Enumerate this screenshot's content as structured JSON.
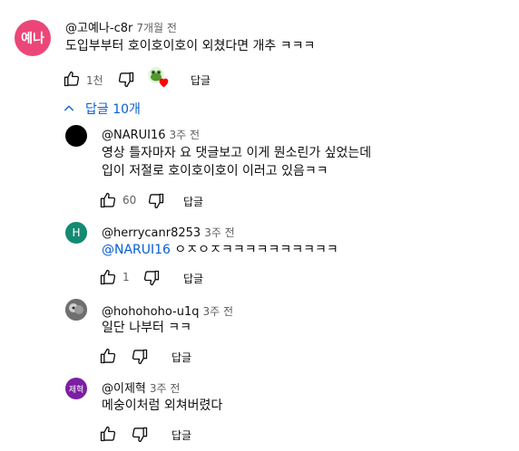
{
  "comment": {
    "avatar_text": "예나",
    "avatar_color": "#ec4679",
    "author": "@고예나-c8r",
    "time": "7개월 전",
    "text": "도입부부터 호이호이호이 외쳤다면 개추 ㅋㅋㅋ",
    "likes": "1천",
    "reply_label": "답글",
    "replies_toggle": "답글 10개"
  },
  "replies": [
    {
      "author": "@NARUI16",
      "time": "3주 전",
      "lines": [
        "영상 틀자마자 요 댓글보고 이게 뭔소린가 싶었는데",
        "입이 저절로 호이호이호이 이러고 있음ㅋㅋ"
      ],
      "likes": "60",
      "reply_label": "답글"
    },
    {
      "author": "@herrycanr8253",
      "time": "3주 전",
      "avatar_text": "H",
      "avatar_color": "#138a72",
      "mention": "@NARUI16",
      "text": " ㅇㅈㅇㅈㅋㅋㅋㅋㅋㅋㅋㅋㅋㅋ",
      "likes": "1",
      "reply_label": "답글"
    },
    {
      "author": "@hohohoho-u1q",
      "time": "3주 전",
      "text": "일단 나부터 ㅋㅋ",
      "reply_label": "답글"
    },
    {
      "author": "@이제혁",
      "time": "3주 전",
      "avatar_text": "제혁",
      "avatar_color": "#7b1fa2",
      "text": "메숭이처럼 외쳐버렸다",
      "reply_label": "답글"
    }
  ]
}
